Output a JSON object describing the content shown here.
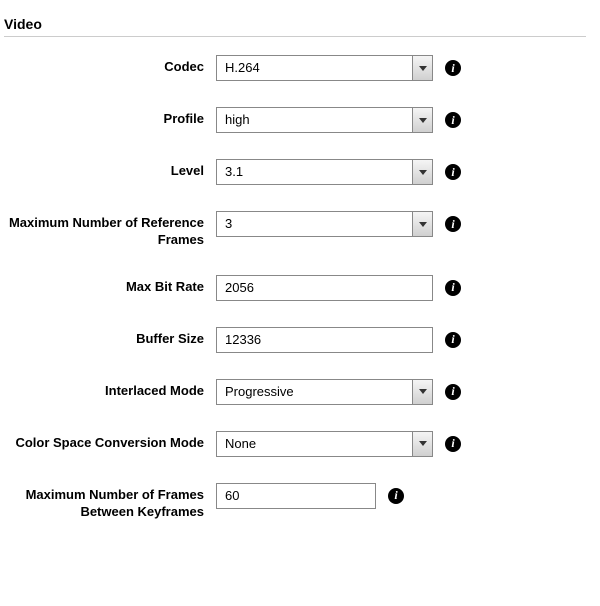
{
  "section": {
    "title": "Video"
  },
  "fields": {
    "codec": {
      "label": "Codec",
      "value": "H.264"
    },
    "profile": {
      "label": "Profile",
      "value": "high"
    },
    "level": {
      "label": "Level",
      "value": "3.1"
    },
    "maxRefFrames": {
      "label": "Maximum Number of Reference Frames",
      "value": "3"
    },
    "maxBitRate": {
      "label": "Max Bit Rate",
      "value": "2056"
    },
    "bufferSize": {
      "label": "Buffer Size",
      "value": "12336"
    },
    "interlaced": {
      "label": "Interlaced Mode",
      "value": "Progressive"
    },
    "colorSpace": {
      "label": "Color Space Conversion Mode",
      "value": "None"
    },
    "maxFramesKey": {
      "label": "Maximum Number of Frames Between Keyframes",
      "value": "60"
    }
  },
  "icons": {
    "info": "i"
  }
}
